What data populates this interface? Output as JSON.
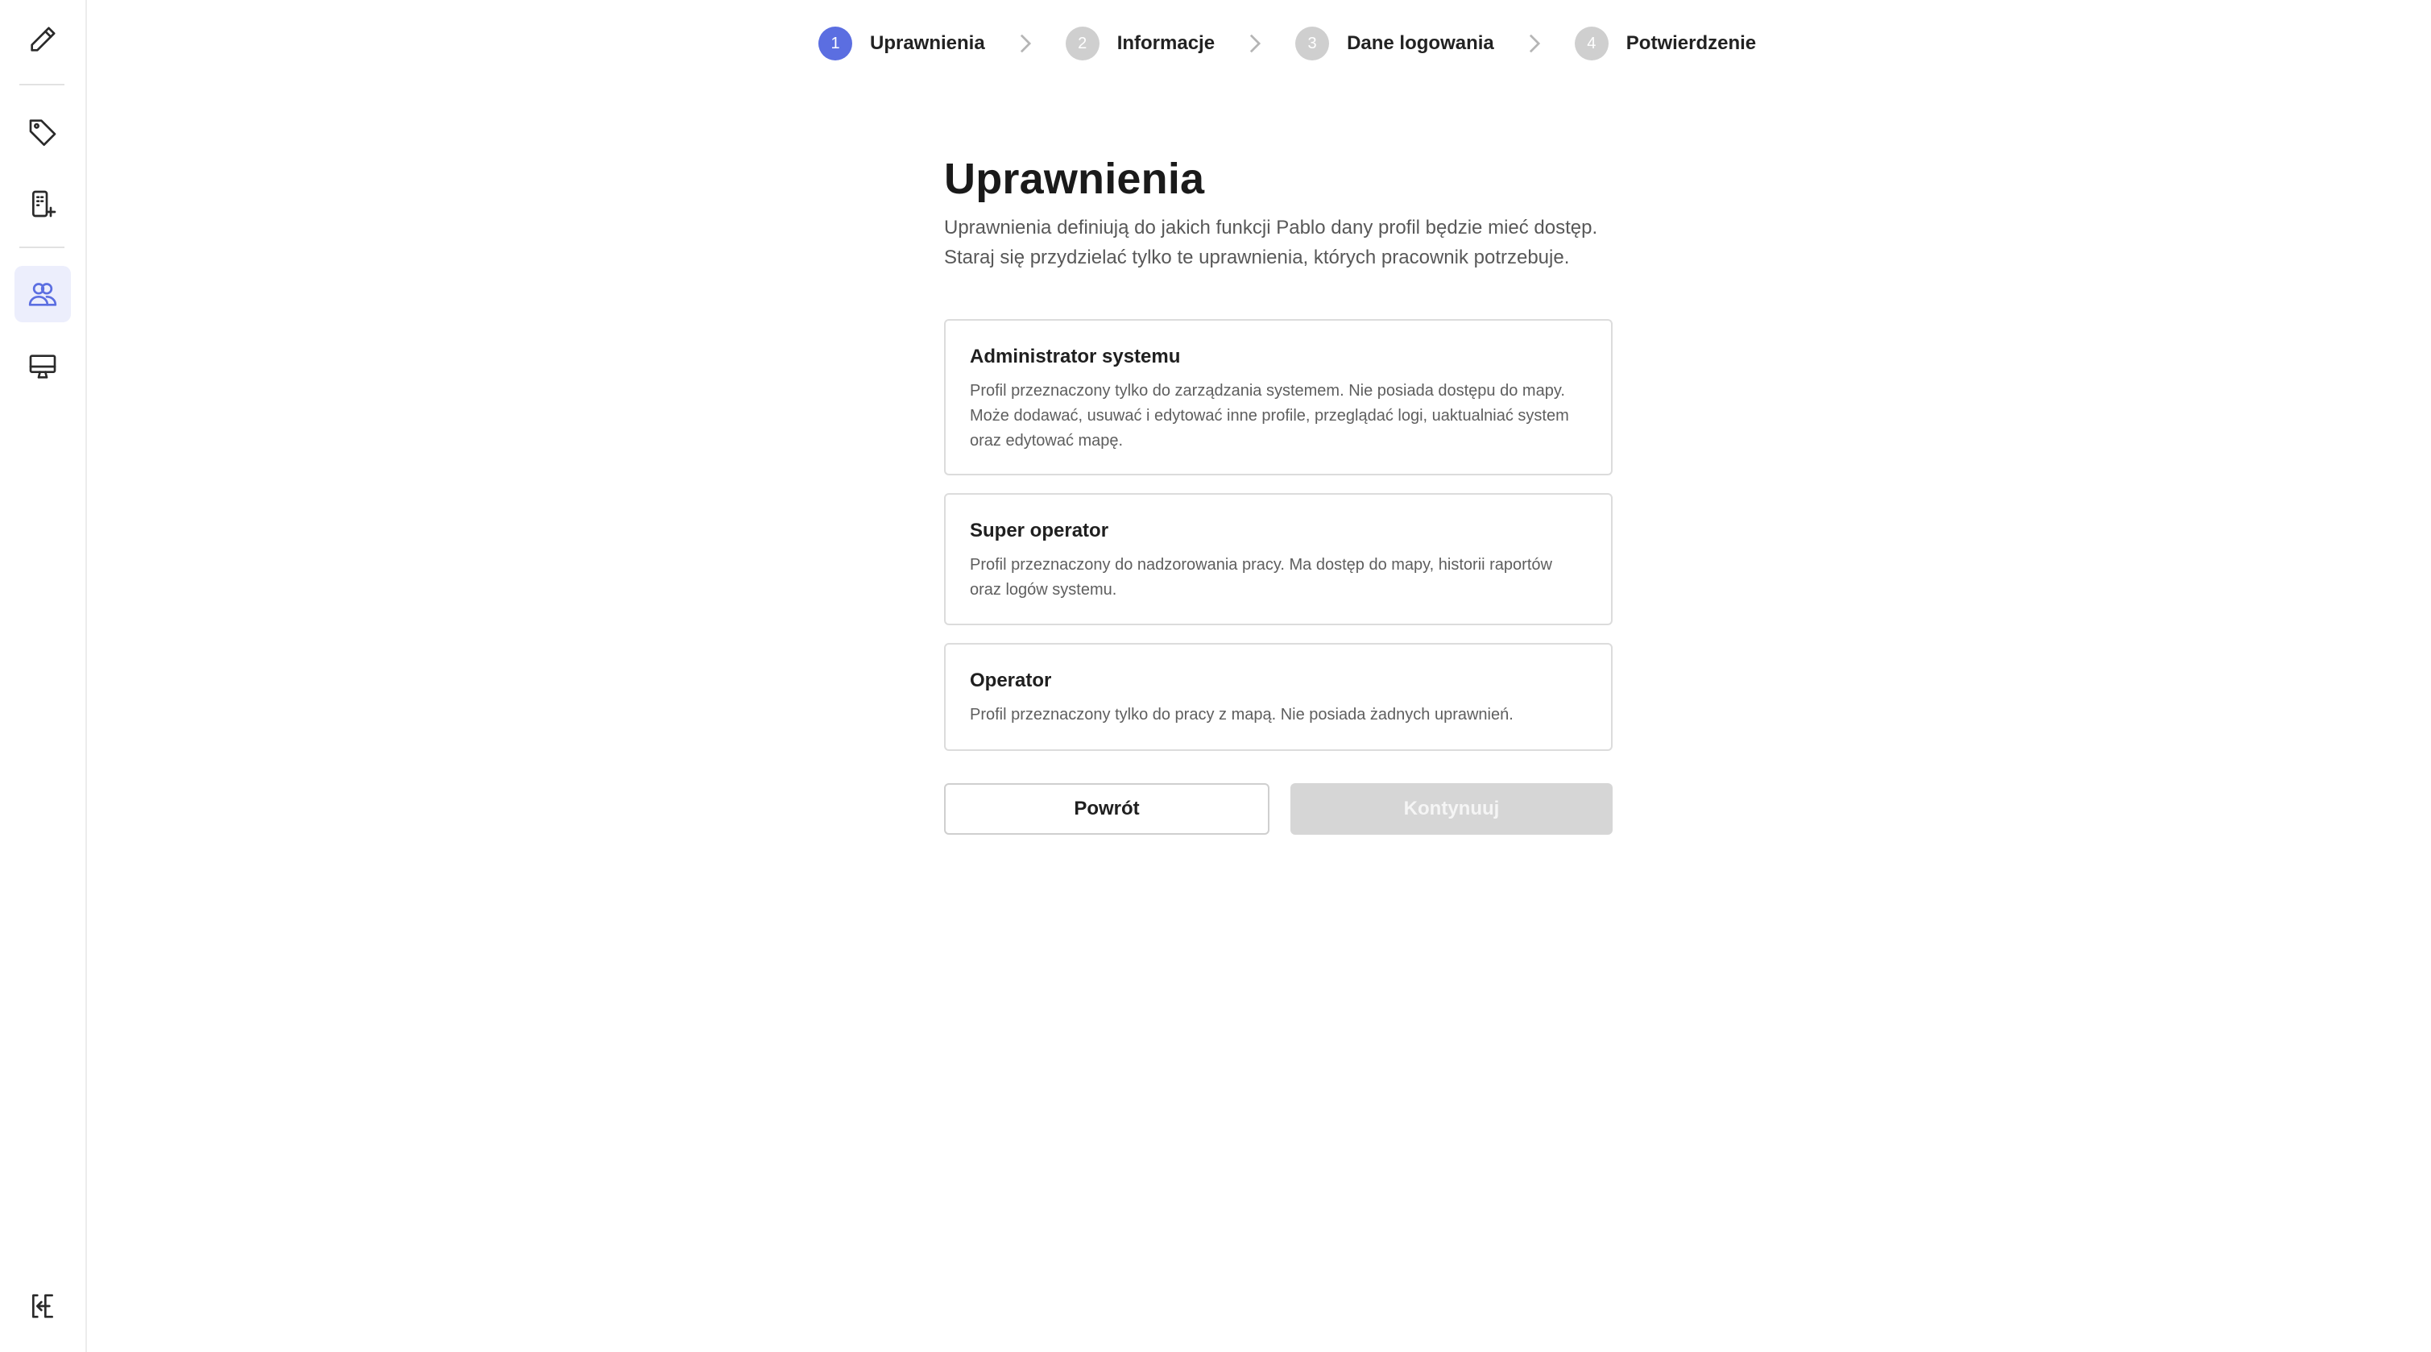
{
  "steps": [
    {
      "num": "1",
      "label": "Uprawnienia"
    },
    {
      "num": "2",
      "label": "Informacje"
    },
    {
      "num": "3",
      "label": "Dane logowania"
    },
    {
      "num": "4",
      "label": "Potwierdzenie"
    }
  ],
  "steps_active_index": 0,
  "main": {
    "title": "Uprawnienia",
    "description": "Uprawnienia definiują do jakich funkcji Pablo dany profil będzie mieć dostęp. Staraj się przydzielać tylko te uprawnienia, których pracownik potrzebuje."
  },
  "roles": [
    {
      "title": "Administrator systemu",
      "description": "Profil przeznaczony tylko do zarządzania systemem. Nie posiada dostępu do mapy. Może dodawać, usuwać i edytować inne profile, przeglądać logi, uaktualniać system oraz edytować mapę."
    },
    {
      "title": "Super operator",
      "description": "Profil przeznaczony do nadzorowania pracy. Ma dostęp do mapy, historii raportów oraz logów systemu."
    },
    {
      "title": "Operator",
      "description": "Profil przeznaczony tylko do pracy z mapą. Nie posiada żadnych uprawnień."
    }
  ],
  "buttons": {
    "back": "Powrót",
    "continue": "Kontynuuj"
  },
  "sidebar": {
    "items": [
      {
        "icon": "pencil-icon"
      },
      {
        "icon": "tag-icon"
      },
      {
        "icon": "device-add-icon"
      },
      {
        "icon": "users-icon",
        "active": true
      },
      {
        "icon": "monitor-icon"
      },
      {
        "icon": "logout-icon"
      }
    ]
  },
  "colors": {
    "accent": "#5b6ee1",
    "active_bg": "#eceefc",
    "disabled": "#d6d6d6"
  }
}
